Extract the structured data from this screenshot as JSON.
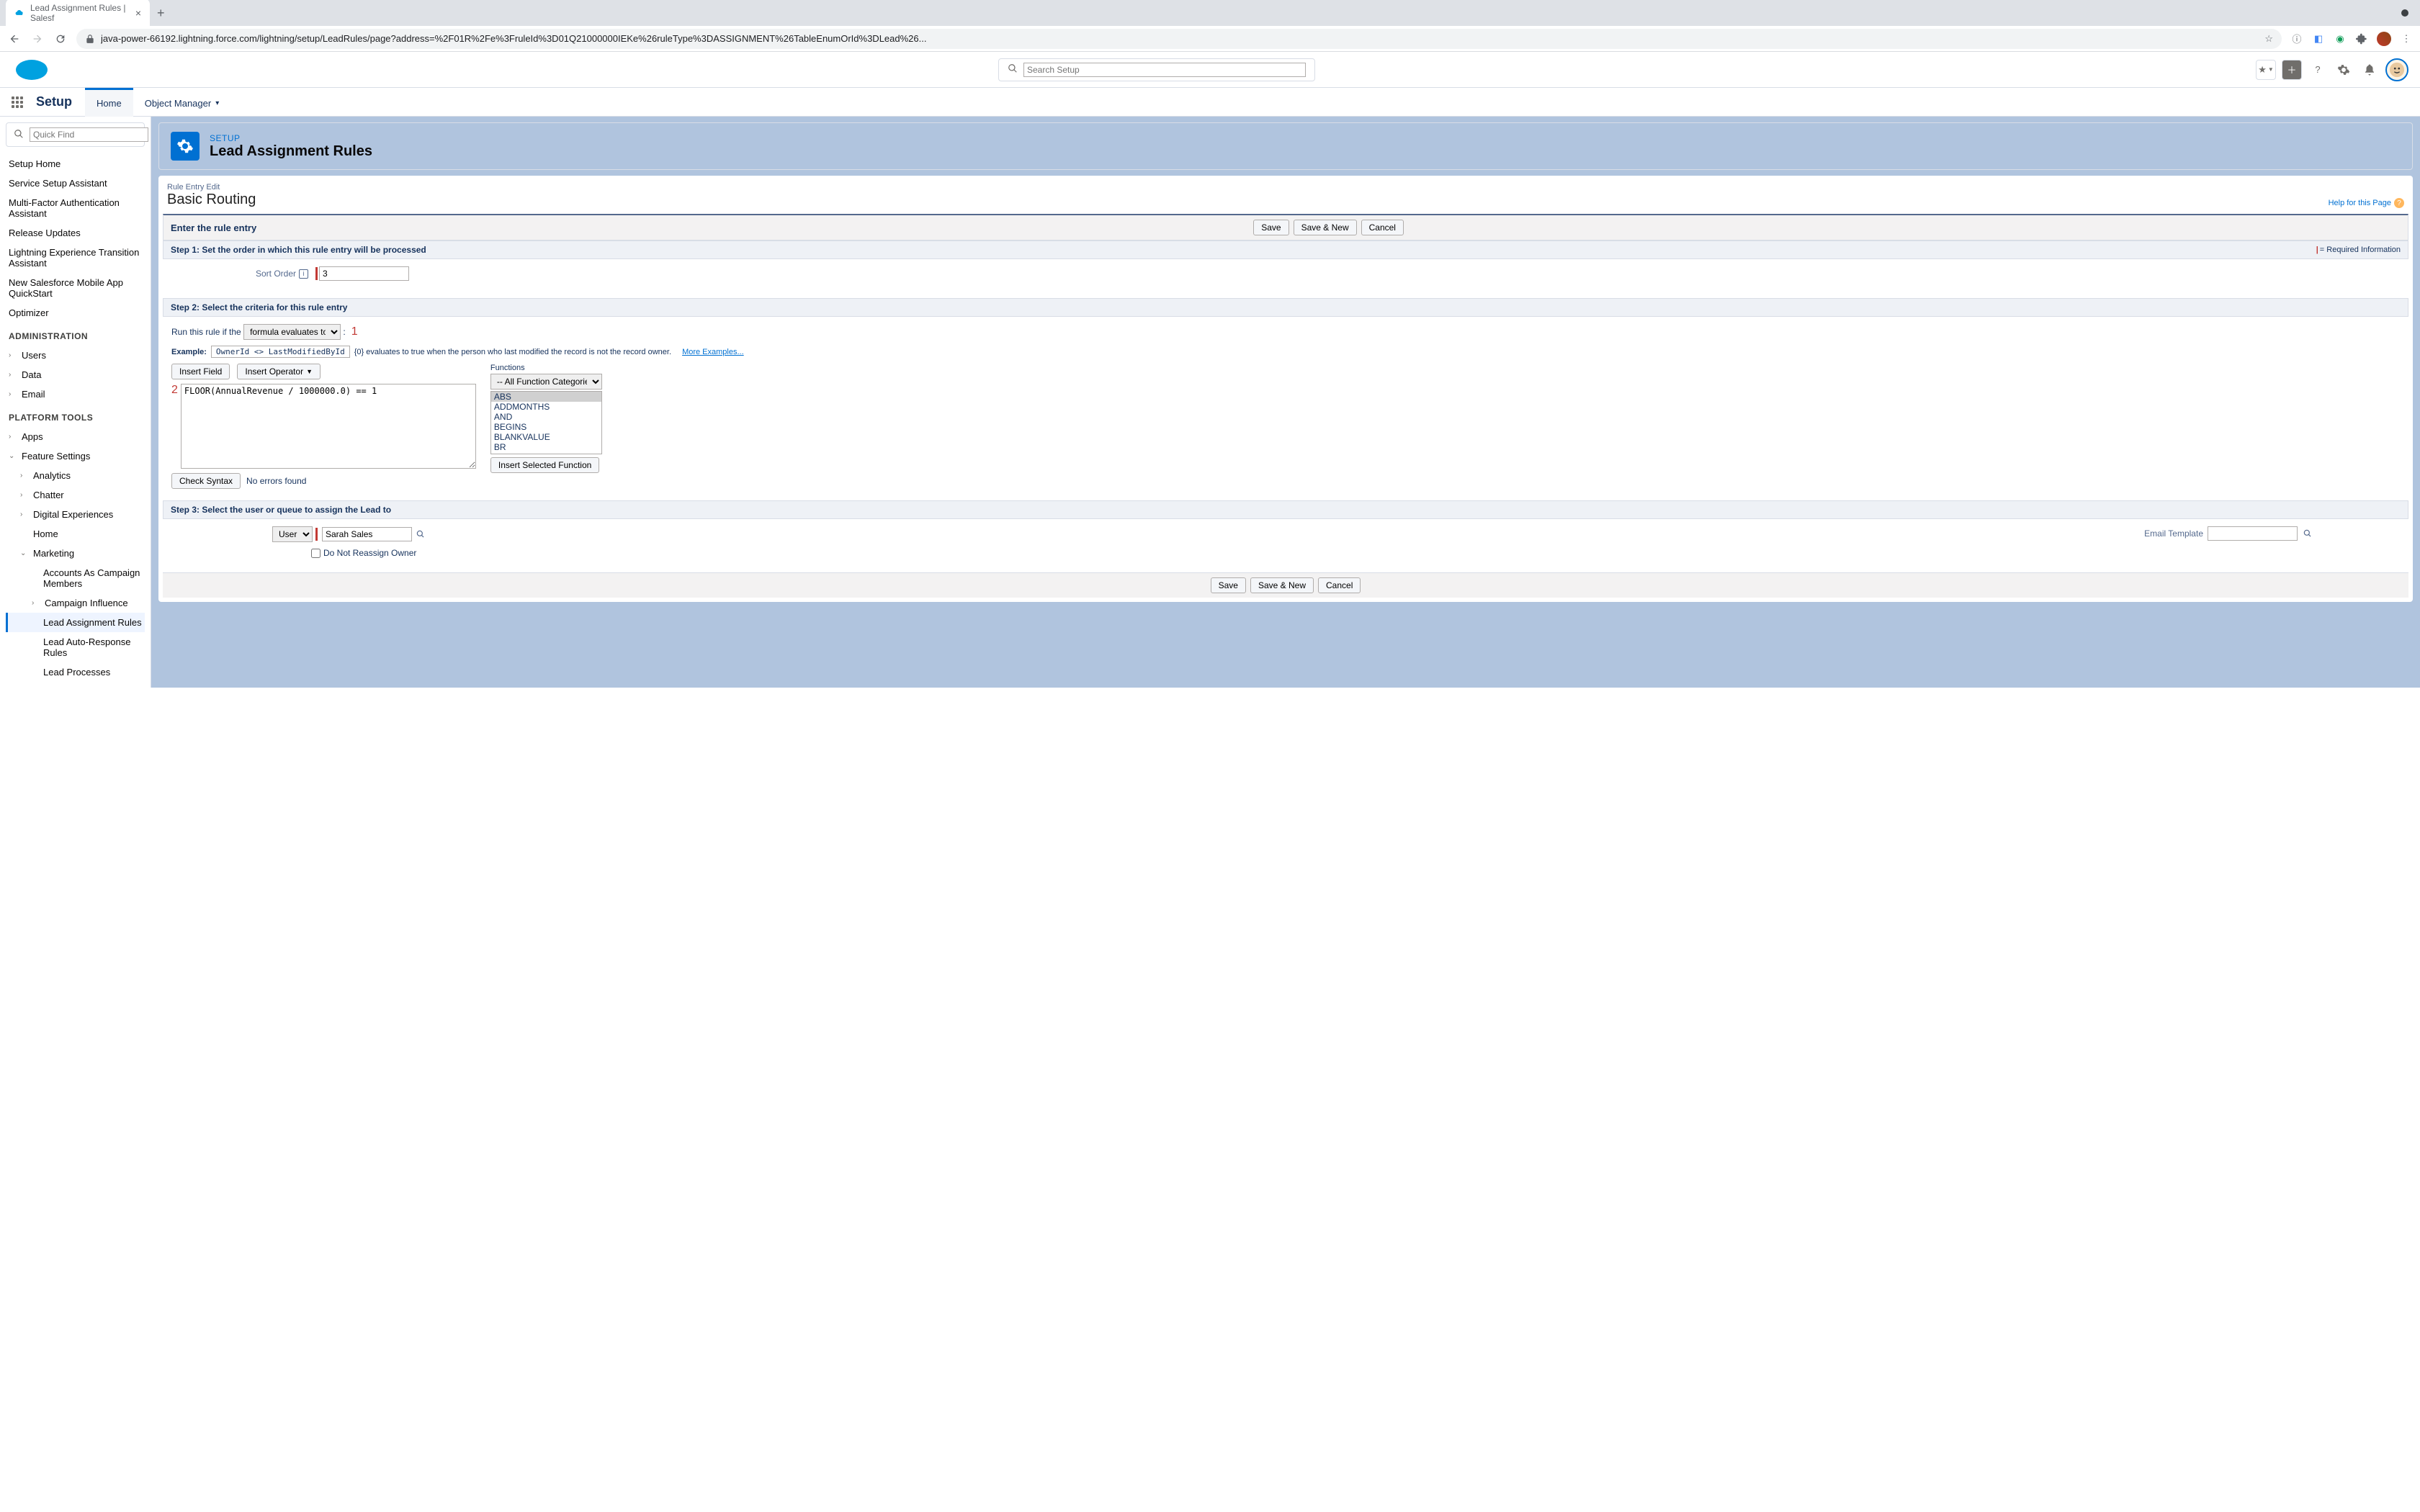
{
  "browser": {
    "tab_title": "Lead Assignment Rules | Salesf",
    "url": "java-power-66192.lightning.force.com/lightning/setup/LeadRules/page?address=%2F01R%2Fe%3FruleId%3D01Q21000000IEKe%26ruleType%3DASSIGNMENT%26TableEnumOrId%3DLead%26..."
  },
  "sf_header": {
    "search_placeholder": "Search Setup"
  },
  "nav": {
    "title": "Setup",
    "tabs": {
      "home": "Home",
      "object_manager": "Object Manager"
    }
  },
  "sidebar": {
    "quick_find_placeholder": "Quick Find",
    "items": {
      "setup_home": "Setup Home",
      "service_setup": "Service Setup Assistant",
      "mfa": "Multi-Factor Authentication Assistant",
      "release": "Release Updates",
      "lex": "Lightning Experience Transition Assistant",
      "mobile": "New Salesforce Mobile App QuickStart",
      "optimizer": "Optimizer",
      "admin_header": "ADMINISTRATION",
      "users": "Users",
      "data": "Data",
      "email": "Email",
      "platform_header": "PLATFORM TOOLS",
      "apps": "Apps",
      "feature": "Feature Settings",
      "analytics": "Analytics",
      "chatter": "Chatter",
      "digital": "Digital Experiences",
      "home": "Home",
      "marketing": "Marketing",
      "accounts_campaign": "Accounts As Campaign Members",
      "campaign_influence": "Campaign Influence",
      "lead_assignment": "Lead Assignment Rules",
      "lead_auto": "Lead Auto-Response Rules",
      "lead_processes": "Lead Processes"
    }
  },
  "page_header": {
    "eyebrow": "SETUP",
    "title": "Lead Assignment Rules"
  },
  "detail": {
    "eyebrow": "Rule Entry Edit",
    "title": "Basic Routing",
    "help": "Help for this Page"
  },
  "buttons": {
    "save": "Save",
    "save_new": "Save & New",
    "cancel": "Cancel"
  },
  "section1": {
    "bar_title": "Enter the rule entry",
    "step_title": "Step 1: Set the order in which this rule entry will be processed",
    "req_text": "= Required Information",
    "sort_label": "Sort Order",
    "sort_value": "3"
  },
  "section2": {
    "step_title": "Step 2: Select the criteria for this rule entry",
    "run_label": "Run this rule if the",
    "criteria_option": "formula evaluates to true",
    "annot1": "1",
    "annot2": "2",
    "example_label": "Example:",
    "example_formula": "OwnerId <> LastModifiedById",
    "example_text": "{0} evaluates to true when the person who last modified the record is not the record owner.",
    "more_examples": "More Examples...",
    "insert_field": "Insert Field",
    "insert_operator": "Insert Operator",
    "formula_value": "FLOOR(AnnualRevenue / 1000000.0) == 1",
    "functions_label": "Functions",
    "func_cat": "-- All Function Categories --",
    "func_list": [
      "ABS",
      "ADDMONTHS",
      "AND",
      "BEGINS",
      "BLANKVALUE",
      "BR"
    ],
    "insert_func": "Insert Selected Function",
    "check_syntax": "Check Syntax",
    "syntax_result": "No errors found"
  },
  "section3": {
    "step_title": "Step 3: Select the user or queue to assign the Lead to",
    "assign_type": "User",
    "assign_value": "Sarah Sales",
    "checkbox_label": "Do Not Reassign Owner",
    "email_label": "Email Template"
  }
}
